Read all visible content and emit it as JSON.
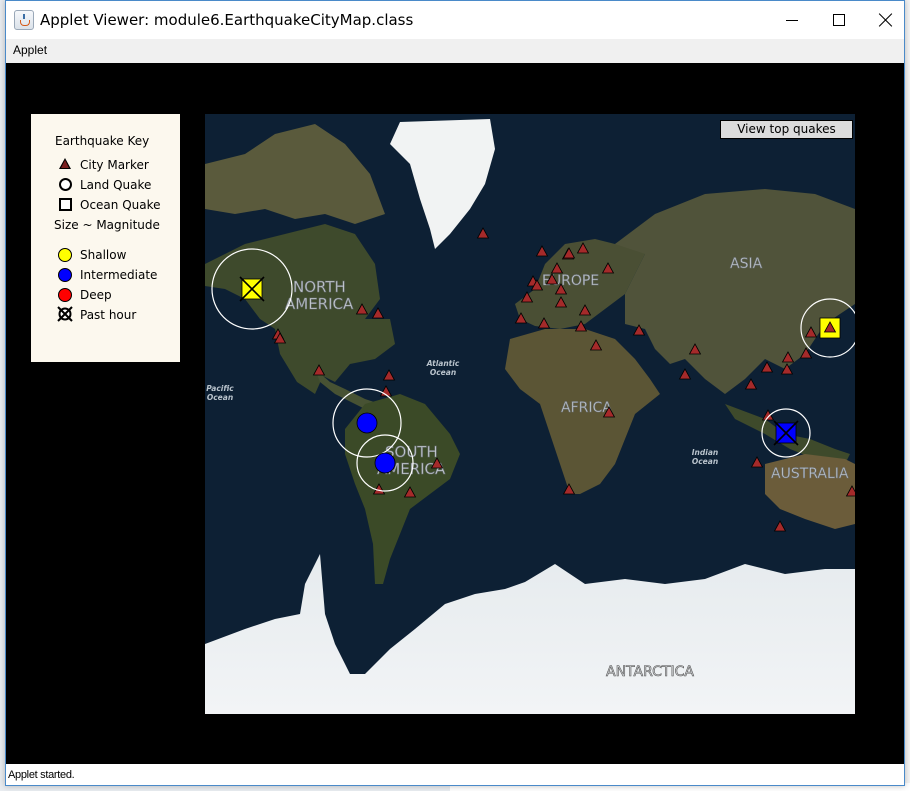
{
  "window": {
    "title": "Applet Viewer: module6.EarthquakeCityMap.class",
    "controls": [
      "minimize",
      "maximize",
      "close"
    ]
  },
  "menubar": {
    "items": [
      "Applet"
    ]
  },
  "status": {
    "text": "Applet started."
  },
  "legend": {
    "title": "Earthquake Key",
    "items": [
      {
        "icon": "triangle-icon",
        "label": "City Marker"
      },
      {
        "icon": "circle-icon",
        "label": "Land Quake"
      },
      {
        "icon": "square-icon",
        "label": "Ocean Quake"
      }
    ],
    "size_note": "Size ~ Magnitude",
    "depth_items": [
      {
        "label": "Shallow",
        "color": "#ffff00"
      },
      {
        "label": "Intermediate",
        "color": "#0000ff"
      },
      {
        "label": "Deep",
        "color": "#ff0000"
      },
      {
        "label": "Past hour",
        "icon": "x-circle-icon"
      }
    ]
  },
  "map": {
    "button_label": "View top quakes",
    "labels": {
      "north_america": [
        "NORTH",
        "AMERICA"
      ],
      "south_america": [
        "SOUTH",
        "AMERICA"
      ],
      "europe": "EUROPE",
      "asia": "ASIA",
      "africa": "AFRICA",
      "australia": "AUSTRALIA",
      "antarctica": "ANTARCTICA",
      "atlantic": [
        "Atlantic",
        "Ocean"
      ],
      "pacific": [
        "Pacific",
        "Ocean"
      ],
      "indian": [
        "Indian",
        "Ocean"
      ]
    },
    "colors": {
      "city": "#a52a2a",
      "shallow": "#ffff00",
      "intermediate": "#0000ff",
      "deep": "#ff0000"
    },
    "quakes": [
      {
        "id": "pacific-nw",
        "type": "ocean",
        "depth": "shallow",
        "past_hour": true
      },
      {
        "id": "peru-north",
        "type": "land",
        "depth": "intermediate",
        "past_hour": false
      },
      {
        "id": "peru-south",
        "type": "land",
        "depth": "intermediate",
        "past_hour": false
      },
      {
        "id": "japan",
        "type": "ocean",
        "depth": "shallow",
        "past_hour": false
      },
      {
        "id": "indonesia",
        "type": "ocean",
        "depth": "intermediate",
        "past_hour": true
      }
    ],
    "city_count": 46
  }
}
